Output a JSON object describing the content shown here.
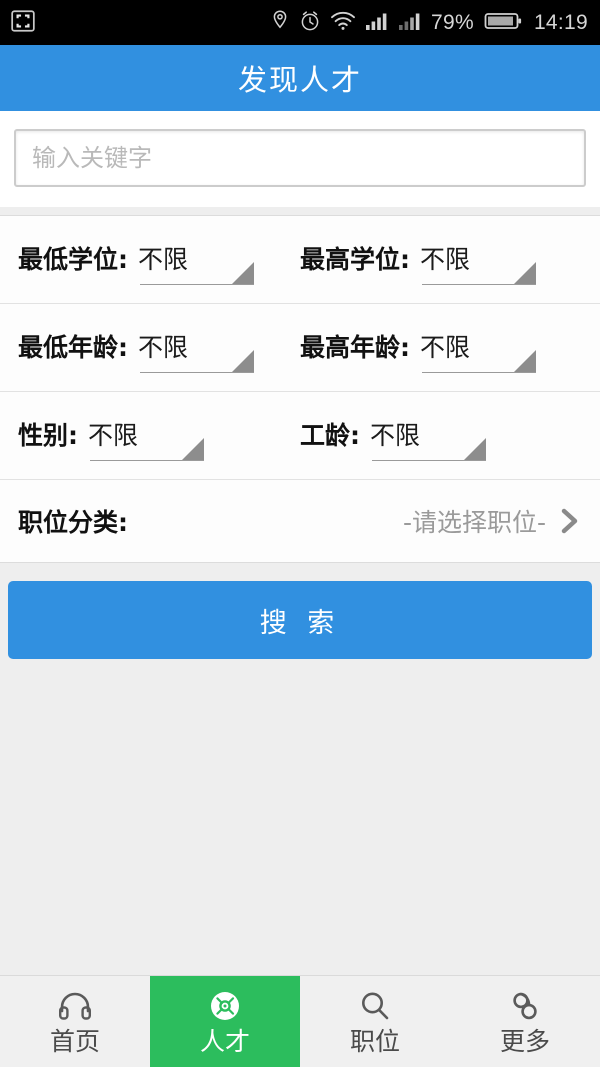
{
  "status_bar": {
    "left_icon": "screenshot-capture-icon",
    "icons": [
      "location-pin-icon",
      "alarm-clock-icon",
      "wifi-icon",
      "signal-bars-icon",
      "signal-bars-sim2-icon"
    ],
    "battery_percent": "79%",
    "battery_icon": "battery-icon",
    "time": "14:19"
  },
  "header": {
    "title": "发现人才",
    "bg_color": "#3190e0"
  },
  "search": {
    "placeholder": "输入关键字",
    "value": ""
  },
  "filters": {
    "rows": [
      {
        "left": {
          "label": "最低学位:",
          "value": "不限"
        },
        "right": {
          "label": "最高学位:",
          "value": "不限"
        }
      },
      {
        "left": {
          "label": "最低年龄:",
          "value": "不限"
        },
        "right": {
          "label": "最高年龄:",
          "value": "不限"
        }
      },
      {
        "left": {
          "label": "性别:",
          "value": "不限"
        },
        "right": {
          "label": "工龄:",
          "value": "不限"
        }
      }
    ],
    "category": {
      "label": "职位分类:",
      "value": "-请选择职位-",
      "chevron": "chevron-right-icon"
    }
  },
  "actions": {
    "search_label": "搜 索",
    "search_color": "#3190e0"
  },
  "bottom_nav": {
    "active_color": "#2cbd5d",
    "items": [
      {
        "label": "首页",
        "icon": "headphones-icon",
        "active": false
      },
      {
        "label": "人才",
        "icon": "talent-disc-icon",
        "active": true
      },
      {
        "label": "职位",
        "icon": "search-magnifier-icon",
        "active": false
      },
      {
        "label": "更多",
        "icon": "more-infinity-icon",
        "active": false
      }
    ]
  }
}
